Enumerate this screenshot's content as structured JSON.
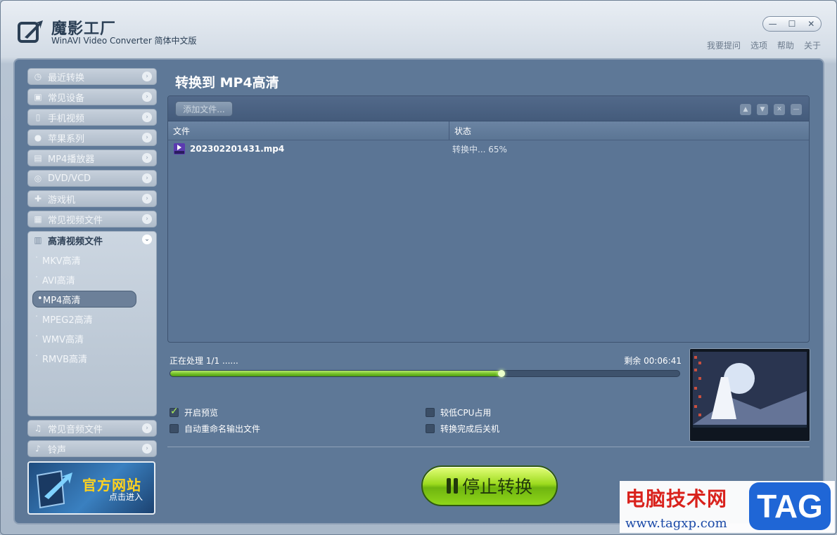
{
  "window": {
    "app_name": "魔影工厂",
    "app_subtitle": "WinAVI Video Converter 简体中文版",
    "controls": {
      "minimize": "—",
      "maximize": "☐",
      "close": "✕"
    },
    "top_links": [
      "我要提问",
      "选项",
      "帮助",
      "关于"
    ]
  },
  "sidebar": {
    "categories_top": [
      {
        "label": "最近转换",
        "icon": "history-icon"
      },
      {
        "label": "常见设备",
        "icon": "device-icon"
      },
      {
        "label": "手机视频",
        "icon": "phone-icon"
      },
      {
        "label": "苹果系列",
        "icon": "apple-icon"
      },
      {
        "label": "MP4播放器",
        "icon": "mp4-player-icon"
      },
      {
        "label": "DVD/VCD",
        "icon": "disc-icon"
      },
      {
        "label": "游戏机",
        "icon": "gamepad-icon"
      },
      {
        "label": "常见视频文件",
        "icon": "video-file-icon"
      }
    ],
    "expanded": {
      "label": "高清视频文件",
      "items": [
        "MKV高清",
        "AVI高清",
        "MP4高清",
        "MPEG2高清",
        "WMV高清",
        "RMVB高清"
      ],
      "active_index": 2
    },
    "categories_bottom": [
      {
        "label": "常见音频文件",
        "icon": "music-icon"
      },
      {
        "label": "铃声",
        "icon": "bell-icon"
      }
    ],
    "promo": {
      "title": "官方网站",
      "subtitle": "点击进入"
    }
  },
  "main": {
    "heading": "转换到 MP4高清",
    "add_file_label": "添加文件...",
    "columns": {
      "file": "文件",
      "status": "状态"
    },
    "files": [
      {
        "name": "202302201431.mp4",
        "status": "转换中... 65%"
      }
    ],
    "progress": {
      "processing": "正在处理 1/1 ......",
      "remaining": "剩余 00:06:41",
      "fraction": 0.65
    },
    "options": [
      {
        "label": "开启预览",
        "checked": true
      },
      {
        "label": "自动重命名输出文件",
        "checked": false
      },
      {
        "label": "较低CPU占用",
        "checked": false
      },
      {
        "label": "转换完成后关机",
        "checked": false
      }
    ],
    "stop_label": "停止转换"
  },
  "watermark": {
    "cn": "电脑技术网",
    "url": "www.tagxp.com",
    "tag": "TAG"
  },
  "colors": {
    "panel_bg": "#5e7897",
    "progress_green": "#6fbd24",
    "accent_text": "#ffffff"
  }
}
